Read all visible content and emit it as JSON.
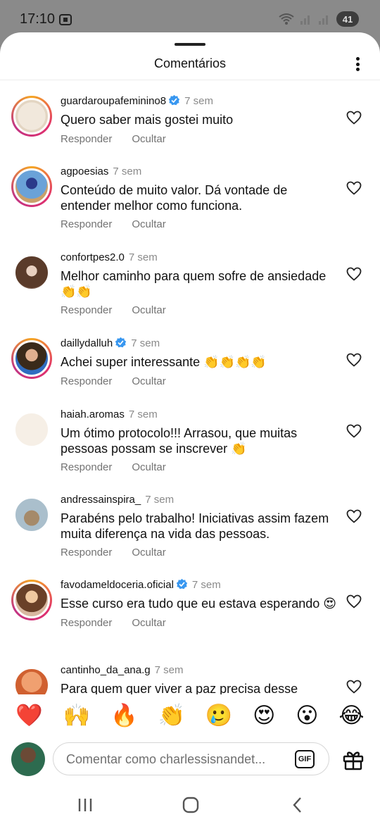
{
  "status_bar": {
    "time": "17:10",
    "battery": "41"
  },
  "sheet": {
    "title": "Comentários"
  },
  "actions": {
    "reply_label": "Responder",
    "hide_label": "Ocultar"
  },
  "comments": [
    {
      "username": "guardaroupafeminino8",
      "verified": true,
      "time": "7 sem",
      "text": "Quero saber mais gostei muito",
      "avatar_story": true
    },
    {
      "username": "agpoesias",
      "verified": false,
      "time": "7 sem",
      "text": "Conteúdo de muito valor. Dá vontade de entender melhor como funciona.",
      "avatar_story": true
    },
    {
      "username": "confortpes2.0",
      "verified": false,
      "time": "7 sem",
      "text": "Melhor caminho para quem sofre de ansiedade 👏👏",
      "avatar_story": false
    },
    {
      "username": "daillydalluh",
      "verified": true,
      "time": "7 sem",
      "text": "Achei super interessante 👏👏👏👏",
      "avatar_story": true
    },
    {
      "username": "haiah.aromas",
      "verified": false,
      "time": "7 sem",
      "text": "Um ótimo protocolo!!! Arrasou, que muitas pessoas possam se inscrever 👏",
      "avatar_story": false
    },
    {
      "username": "andressainspira_",
      "verified": false,
      "time": "7 sem",
      "text": "Parabéns pelo trabalho! Iniciativas assim fazem muita diferença na vida das pessoas.",
      "avatar_story": false
    },
    {
      "username": "favodameldoceria.oficial",
      "verified": true,
      "time": "7 sem",
      "text": "Esse curso era tudo que eu estava esperando 😍",
      "avatar_story": true
    },
    {
      "username": "cantinho_da_ana.g",
      "verified": false,
      "time": "7 sem",
      "text": "Para quem quer viver a paz precisa desse",
      "avatar_story": false
    }
  ],
  "emoji_bar": [
    "❤️",
    "🙌",
    "🔥",
    "👏",
    "🥲",
    "😍",
    "😮",
    "😂"
  ],
  "composer": {
    "placeholder": "Comentar como charlessisnandet...",
    "gif_label": "GIF"
  },
  "colors": {
    "verified_blue": "#3897f0",
    "secondary_text": "#737373"
  }
}
